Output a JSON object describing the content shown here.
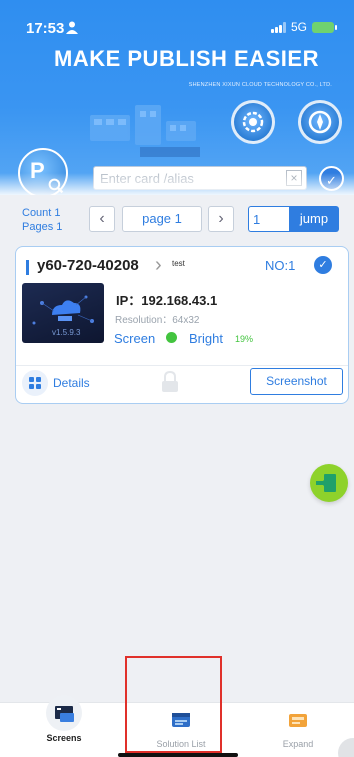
{
  "status_bar": {
    "time": "17:53",
    "network": "5G"
  },
  "banner": {
    "title": "MAKE PUBLISH EASIER",
    "subtitle": "SHENZHEN XIXUN CLOUD TECHNOLOGY CO., LTD.",
    "logo_text": "P"
  },
  "search": {
    "placeholder": "Enter card /alias",
    "value": ""
  },
  "pagination": {
    "count_label": "Count 1",
    "pages_label": "Pages 1",
    "prev_icon": "chevron-left-icon",
    "next_icon": "chevron-right-icon",
    "current_page_label": "page 1",
    "jump_input_value": "1",
    "jump_label": "jump"
  },
  "card": {
    "name": "y60-720-40208",
    "alias": "test",
    "number_label": "NO:1",
    "thumbnail_version": "v1.5.9.3",
    "ip_label": "IP：192.168.43.1",
    "resolution_label": "Resolution：64x32",
    "screen_label": "Screen",
    "screen_status_color": "#43c43f",
    "bright_label": "Bright",
    "bright_value": "19%",
    "details_label": "Details",
    "screenshot_label": "Screenshot"
  },
  "tabs": [
    {
      "label": "Screens",
      "icon": "screens-icon",
      "active": true
    },
    {
      "label": "Solution List",
      "icon": "solution-list-icon",
      "active": false
    },
    {
      "label": "Expand",
      "icon": "expand-icon",
      "active": false
    }
  ],
  "colors": {
    "accent": "#2f7de0",
    "green": "#43c43f",
    "highlight": "#e0302a"
  }
}
